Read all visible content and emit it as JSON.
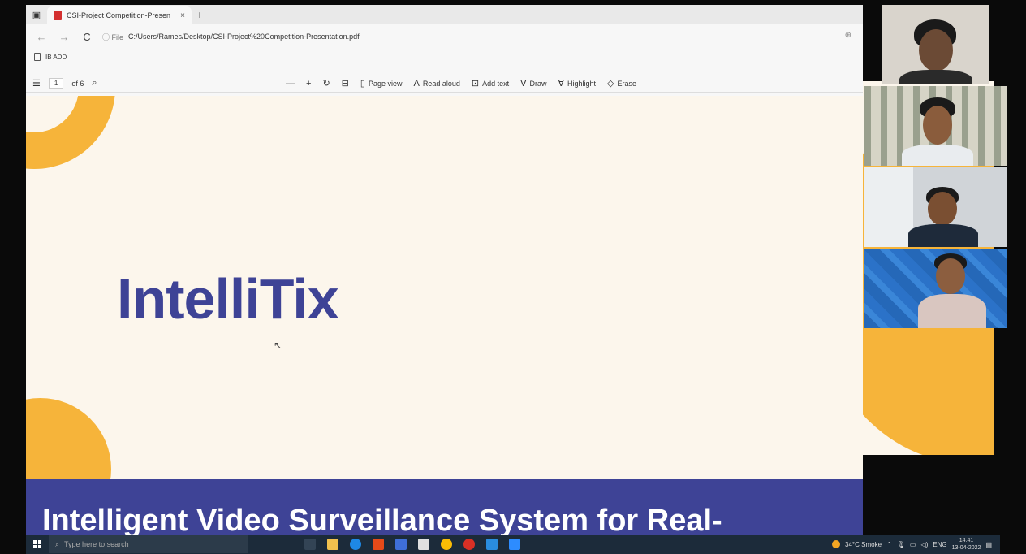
{
  "browser": {
    "tab": {
      "title": "CSI-Project Competition-Presen",
      "close": "×",
      "new": "+"
    },
    "address": {
      "back": "←",
      "forward": "→",
      "refresh": "C",
      "info": "ⓘ File",
      "url": "C:/Users/Rames/Desktop/CSI-Project%20Competition-Presentation.pdf"
    },
    "favorites": {
      "item": "IB ADD"
    }
  },
  "pdf_toolbar": {
    "page_current": "1",
    "page_total": "of 6",
    "page_view": "Page view",
    "read_aloud": "Read aloud",
    "add_text": "Add text",
    "draw": "Draw",
    "highlight": "Highlight",
    "erase": "Erase"
  },
  "slide": {
    "title": "IntelliTix",
    "band_text": "Intelligent Video Surveillance System for Real-",
    "accent_color": "#f6b43a",
    "brand_color": "#3e4396",
    "background_color": "#fcf6ec"
  },
  "taskbar": {
    "search_placeholder": "Type here to search",
    "weather": "34°C Smoke",
    "lang": "ENG",
    "time": "14:41",
    "date": "13-04-2022"
  }
}
